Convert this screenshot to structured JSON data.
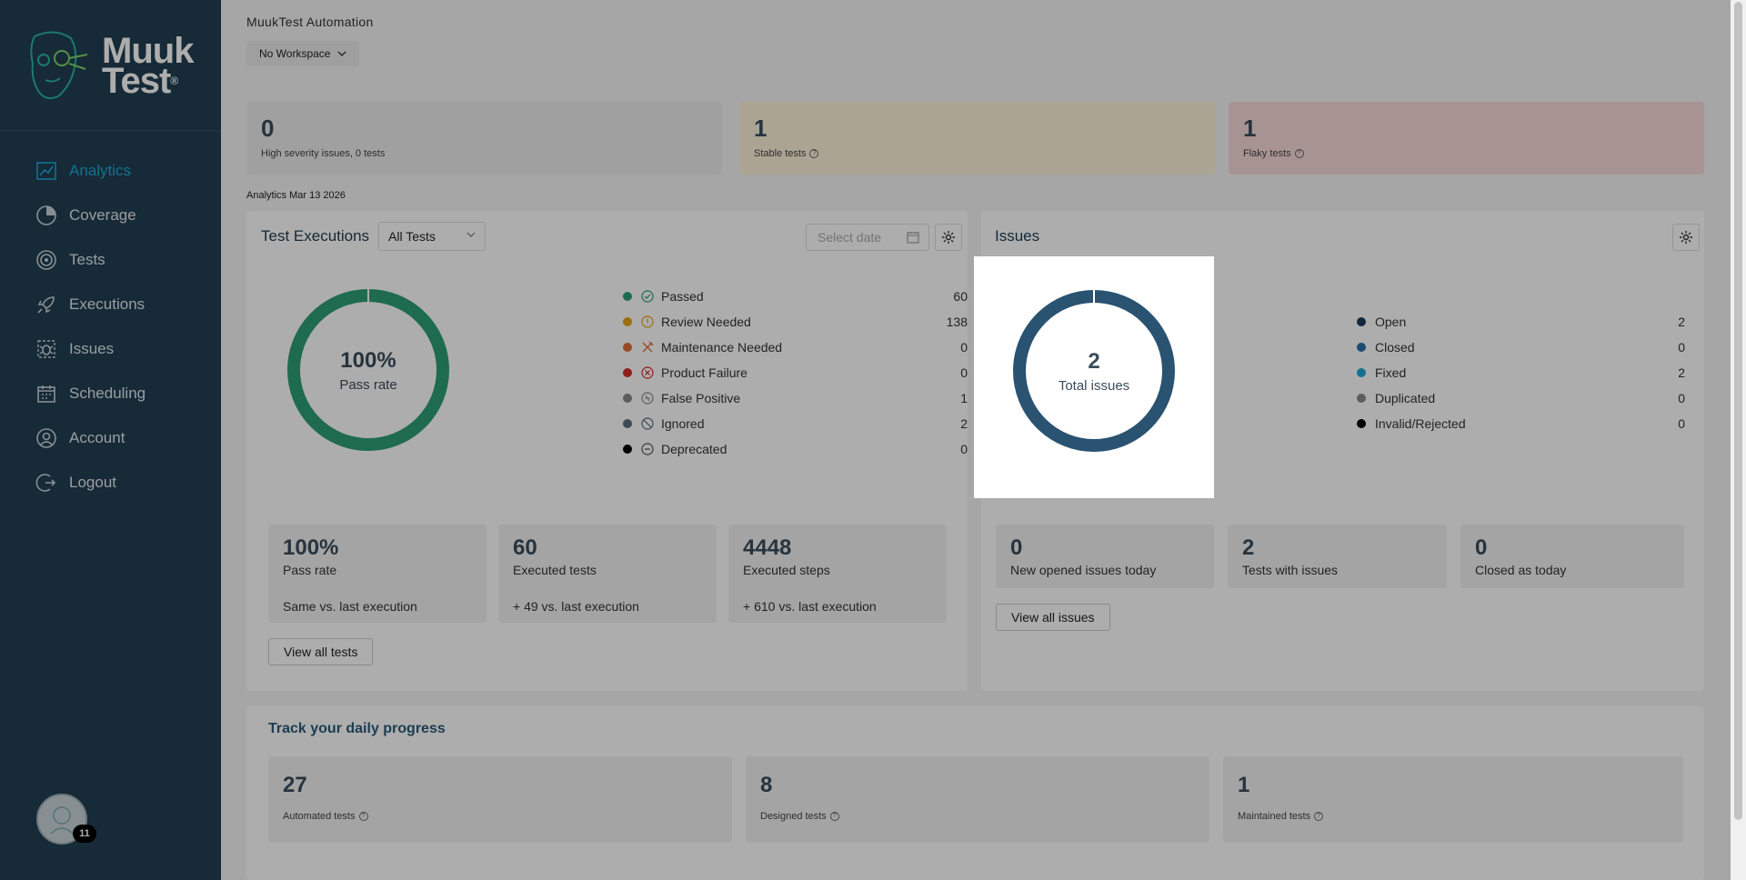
{
  "sidebar": {
    "logo_line1": "Muuk",
    "logo_line2": "Test",
    "logo_reg": "®",
    "items": [
      {
        "label": "Analytics",
        "icon": "chart-line-icon",
        "active": true
      },
      {
        "label": "Coverage",
        "icon": "pie-chart-icon",
        "active": false
      },
      {
        "label": "Tests",
        "icon": "target-icon",
        "active": false
      },
      {
        "label": "Executions",
        "icon": "rocket-icon",
        "active": false
      },
      {
        "label": "Issues",
        "icon": "bug-icon",
        "active": false
      },
      {
        "label": "Scheduling",
        "icon": "calendar-icon",
        "active": false
      },
      {
        "label": "Account",
        "icon": "user-icon",
        "active": false
      },
      {
        "label": "Logout",
        "icon": "logout-icon",
        "active": false
      }
    ],
    "avatar_badge": "11",
    "accent": "#1ea7d8",
    "background": "#213e52"
  },
  "header": {
    "org_title": "MuukTest Automation",
    "workspace": "No Workspace"
  },
  "kpis": [
    {
      "value": "0",
      "label": "High severity issues, 0 tests"
    },
    {
      "value": "1",
      "label": "Stable tests"
    },
    {
      "value": "1",
      "label": "Flaky tests"
    }
  ],
  "analytics_date": "Analytics Mar 13 2026",
  "executions": {
    "title": "Test Executions",
    "filter": "All Tests",
    "date_placeholder": "Select date",
    "donut_value": "100%",
    "donut_label": "Pass rate",
    "donut_color": "#2e9e75",
    "legend": [
      {
        "label": "Passed",
        "value": "60",
        "color": "#2e9e75",
        "icon": "check-circle-icon"
      },
      {
        "label": "Review Needed",
        "value": "138",
        "color": "#e8a317",
        "icon": "alert-circle-icon"
      },
      {
        "label": "Maintenance Needed",
        "value": "0",
        "color": "#e36d3d",
        "icon": "tools-icon"
      },
      {
        "label": "Product Failure",
        "value": "0",
        "color": "#d62a2a",
        "icon": "x-circle-icon"
      },
      {
        "label": "False Positive",
        "value": "1",
        "color": "#8a8a8a",
        "icon": "false-positive-icon"
      },
      {
        "label": "Ignored",
        "value": "2",
        "color": "#5a6f7f",
        "icon": "ban-icon"
      },
      {
        "label": "Deprecated",
        "value": "0",
        "color": "#000000",
        "icon": "minus-circle-icon"
      }
    ],
    "stats": [
      {
        "value": "100%",
        "label": "Pass rate",
        "sub": "Same vs. last execution"
      },
      {
        "value": "60",
        "label": "Executed tests",
        "sub": "+ 49 vs. last execution"
      },
      {
        "value": "4448",
        "label": "Executed steps",
        "sub": "+ 610 vs. last execution"
      }
    ],
    "view_all": "View all tests"
  },
  "issues": {
    "title": "Issues",
    "donut_value": "2",
    "donut_label": "Total issues",
    "donut_color": "#2a5271",
    "legend": [
      {
        "label": "Open",
        "value": "2",
        "color": "#1d3a56"
      },
      {
        "label": "Closed",
        "value": "0",
        "color": "#2a6fa8"
      },
      {
        "label": "Fixed",
        "value": "2",
        "color": "#1ea7d8"
      },
      {
        "label": "Duplicated",
        "value": "0",
        "color": "#8a8a8a"
      },
      {
        "label": "Invalid/Rejected",
        "value": "0",
        "color": "#000000"
      }
    ],
    "stats": [
      {
        "value": "0",
        "label": "New opened issues today"
      },
      {
        "value": "2",
        "label": "Tests with issues"
      },
      {
        "value": "0",
        "label": "Closed as today"
      }
    ],
    "view_all": "View all issues"
  },
  "progress": {
    "title": "Track your daily progress",
    "cards": [
      {
        "value": "27",
        "label": "Automated tests"
      },
      {
        "value": "8",
        "label": "Designed tests"
      },
      {
        "value": "1",
        "label": "Maintained tests"
      }
    ]
  }
}
